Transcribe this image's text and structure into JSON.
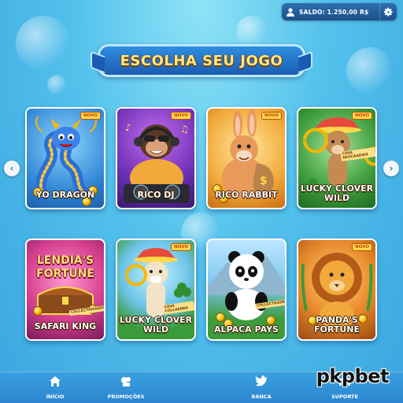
{
  "header": {
    "balance_label": "SALDO: 1.250,00 R$",
    "user_icon": "user-icon",
    "settings_icon": "gear-icon"
  },
  "title": "ESCOLHA SEU JOGO",
  "carousel": {
    "prev_icon": "chevron-left-icon",
    "next_icon": "chevron-right-icon"
  },
  "games": [
    {
      "title": "YO DRAGON",
      "badge": "NOVO"
    },
    {
      "title": "RICO DJ",
      "badge": "NOVO"
    },
    {
      "title": "RICO RABBIT",
      "badge": "NOVO"
    },
    {
      "title": "LUCKY CLOVER WILD",
      "badge": "NOVO",
      "tag": "CAVA REOCAADIER"
    },
    {
      "title": "SAFARI KING",
      "art_title": "LENDIA'S FORTUNE",
      "tag": "COLLECTRMADER"
    },
    {
      "title": "LUCKY CLOVER WILD",
      "badge": "NOVO",
      "tag": "CAVA COLLAEDER"
    },
    {
      "title": "ALPACA PAYS",
      "tag": "COLLECTRADRS"
    },
    {
      "title": "PANDA'S FORTUNE",
      "badge": "NOVO"
    }
  ],
  "nav": [
    {
      "label": "INÍCIO",
      "icon": "home-icon"
    },
    {
      "label": "PROMOÇÕES",
      "icon": "gift-icon"
    },
    {
      "label": "BANCA",
      "icon": "bird-icon"
    },
    {
      "label": "SUPORTE",
      "icon": "support-icon"
    }
  ],
  "watermark": "pkpbet",
  "colors": {
    "background": "#53c1ec",
    "banner": "#1a5cb3",
    "title_text": "#ffe98a",
    "badge": "#ffd84a",
    "nav": "#2c86cf"
  }
}
